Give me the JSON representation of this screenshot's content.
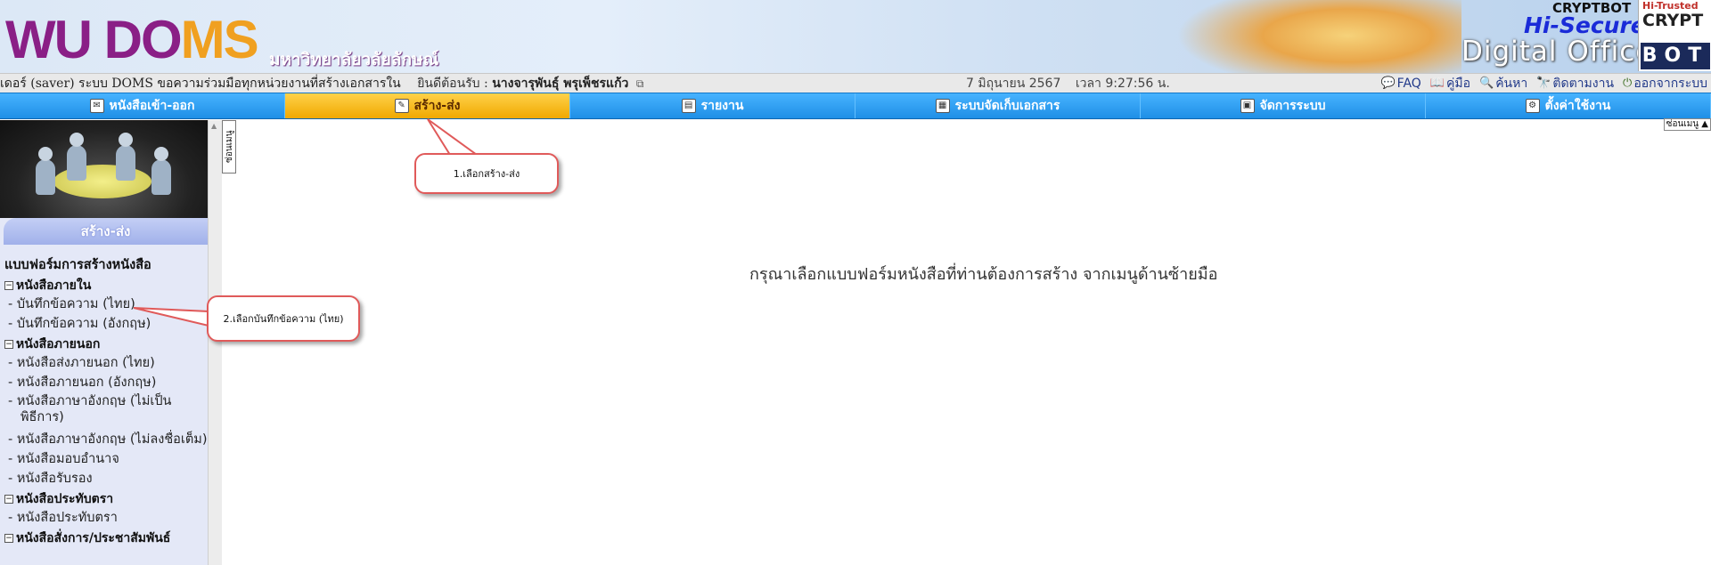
{
  "banner": {
    "logo_main": "WU DOMS",
    "university": "มหาวิทยาลัยวลัยลักษณ์",
    "brand_top": "CRYPTBOT",
    "brand_secure": "Hi-Secure",
    "brand_digital": "Digital Office",
    "crypt_hi": "Hi-Trusted",
    "crypt_name": "CRYPT",
    "crypt_bot": "BOT"
  },
  "infobar": {
    "system_text": "เดอร์ (saver) ระบบ DOMS  ขอความร่วมมือทุกหน่วยงานที่สร้างเอกสารใน",
    "welcome": "ยินดีต้อนรับ  :",
    "user": "นางจารุพันธุ์ พรุเพ็ชรแก้ว",
    "date": "7 มิถุนายน 2567",
    "time": "เวลา 9:27:56 น.",
    "links": {
      "faq": "FAQ",
      "manual": "คู่มือ",
      "search": "ค้นหา",
      "track": "ติดตามงาน",
      "logout": "ออกจากระบบ"
    }
  },
  "mainmenu": {
    "inbox": "หนังสือเข้า-ออก",
    "create": "สร้าง-ส่ง",
    "report": "รายงาน",
    "archive": "ระบบจัดเก็บเอกสาร",
    "admin": "จัดการระบบ",
    "settings": "ตั้งค่าใช้งาน"
  },
  "sidebar": {
    "header": "สร้าง-ส่ง",
    "title": "แบบฟอร์มการสร้างหนังสือ",
    "groups": {
      "internal": "หนังสือภายใน",
      "external": "หนังสือภายนอก",
      "stamp": "หนังสือประทับตรา",
      "order": "หนังสือสั่งการ/ประชาสัมพันธ์"
    },
    "items": {
      "memo_th": "- บันทึกข้อความ (ไทย)",
      "memo_en": "- บันทึกข้อความ (อังกฤษ)",
      "ext_th": "- หนังสือส่งภายนอก (ไทย)",
      "ext_en": "- หนังสือภายนอก (อังกฤษ)",
      "en_informal": "- หนังสือภาษาอังกฤษ (ไม่เป็นพิธีการ)",
      "en_nosign": "- หนังสือภาษาอังกฤษ (ไม่ลงชื่อเต็ม)",
      "delegate": "- หนังสือมอบอำนาจ",
      "certify": "- หนังสือรับรอง",
      "stamp_item": "- หนังสือประทับตรา"
    }
  },
  "collapse_tab": "ซ่อนเมนู",
  "hide_menu": "ซ่อนเมนู ▲",
  "main_message": "กรุณาเลือกแบบฟอร์มหนังสือที่ท่านต้องการสร้าง จากเมนูด้านซ้ายมือ",
  "callouts": {
    "step1": "1.เลือกสร้าง-ส่ง",
    "step2": "2.เลือกบันทึกข้อความ (ไทย)"
  },
  "colors": {
    "menu_blue": "#1f8fe6",
    "menu_active": "#f0a800",
    "callout_border": "#e05a5a",
    "logo_purple": "#8a1f86"
  }
}
